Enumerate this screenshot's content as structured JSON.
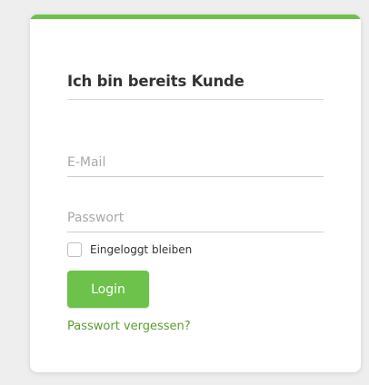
{
  "colors": {
    "accent": "#6cc24a",
    "link": "#5a9f2f",
    "background": "#eeeeee",
    "card": "#ffffff"
  },
  "login": {
    "title": "Ich bin bereits Kunde",
    "email": {
      "value": "",
      "placeholder": "E-Mail"
    },
    "password": {
      "value": "",
      "placeholder": "Passwort"
    },
    "remember_me": {
      "label": "Eingeloggt bleiben",
      "checked": false
    },
    "submit_label": "Login",
    "forgot_password_label": "Passwort vergessen?"
  }
}
